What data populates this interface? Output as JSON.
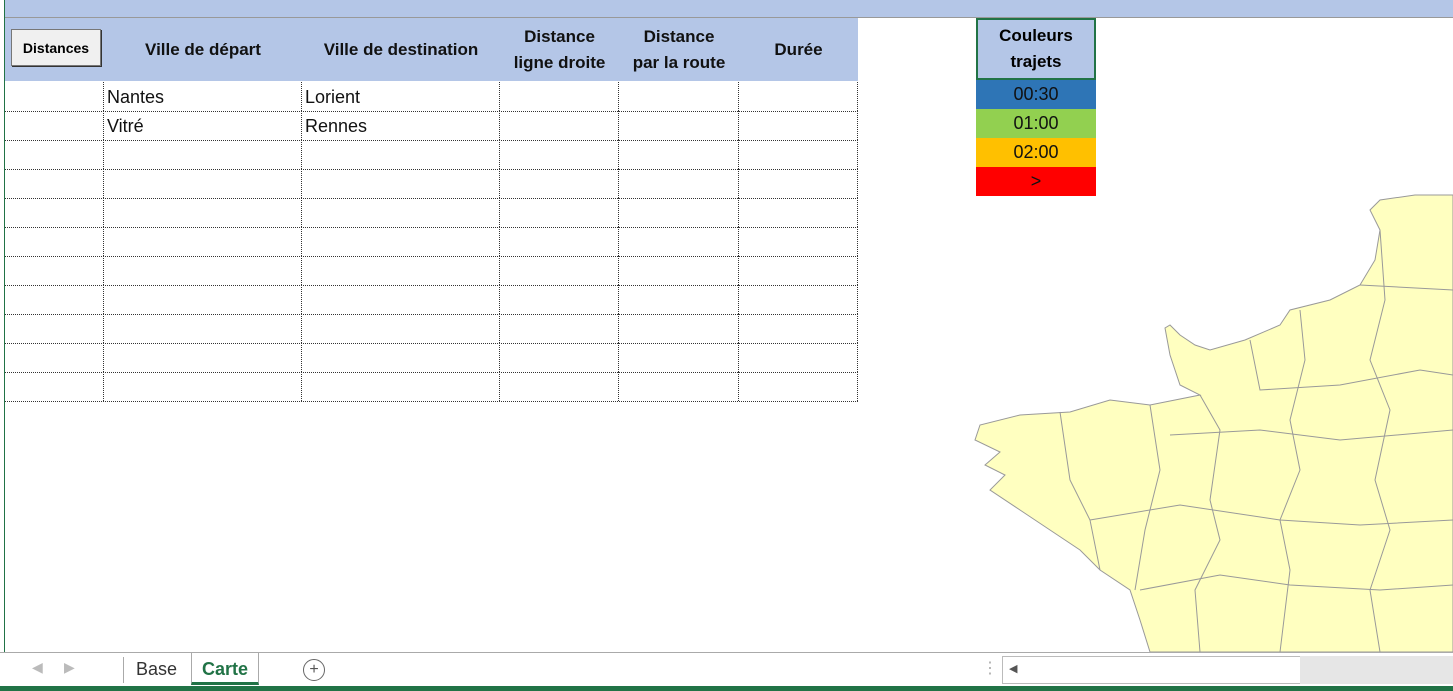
{
  "table": {
    "button_label": "Distances",
    "headers": [
      "Ville de départ",
      "Ville de destination",
      "Distance\nligne droite",
      "Distance\npar la route",
      "Durée"
    ],
    "rows": [
      [
        "Nantes",
        "Lorient",
        "",
        "",
        ""
      ],
      [
        "Vitré",
        "Rennes",
        "",
        "",
        ""
      ],
      [
        "",
        "",
        "",
        "",
        ""
      ],
      [
        "",
        "",
        "",
        "",
        ""
      ],
      [
        "",
        "",
        "",
        "",
        ""
      ],
      [
        "",
        "",
        "",
        "",
        ""
      ],
      [
        "",
        "",
        "",
        "",
        ""
      ],
      [
        "",
        "",
        "",
        "",
        ""
      ],
      [
        "",
        "",
        "",
        "",
        ""
      ],
      [
        "",
        "",
        "",
        "",
        ""
      ],
      [
        "",
        "",
        "",
        "",
        ""
      ]
    ]
  },
  "legend": {
    "title": "Couleurs\ntrajets",
    "items": [
      {
        "label": "00:30",
        "color": "#2e75b6"
      },
      {
        "label": "01:00",
        "color": "#92d050"
      },
      {
        "label": "02:00",
        "color": "#ffc000"
      },
      {
        "label": ">",
        "color": "#ff0000"
      }
    ]
  },
  "sheets": {
    "tabs": [
      "Base",
      "Carte"
    ],
    "active": "Carte"
  }
}
